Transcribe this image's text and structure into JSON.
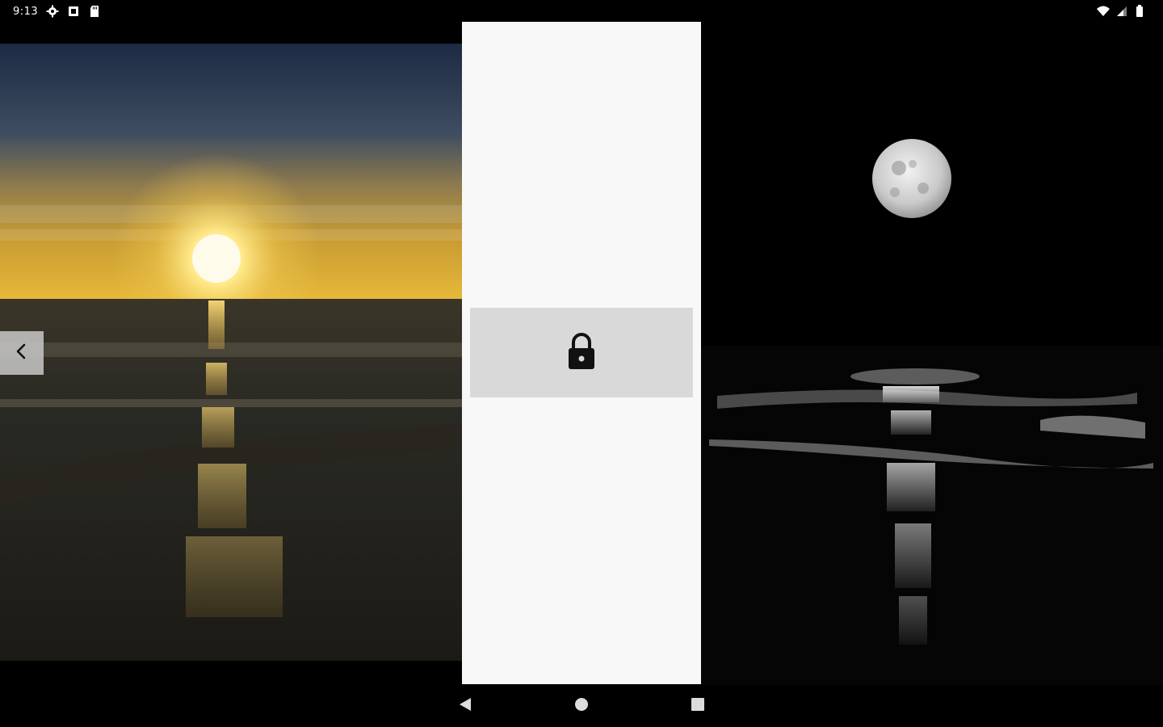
{
  "status_bar": {
    "time": "9:13",
    "left_icons": [
      "settings-icon",
      "sim-card-icon",
      "sd-card-icon"
    ],
    "right_icons": [
      "wifi-icon",
      "cell-signal-icon",
      "battery-icon"
    ]
  },
  "wallpapers": {
    "left": {
      "scene": "sunset-over-ocean"
    },
    "right": {
      "scene": "moon-over-ocean"
    }
  },
  "center_card": {
    "lock_icon": "lock-icon"
  },
  "nav_bar": {
    "buttons": [
      "back-icon",
      "home-icon",
      "recents-icon"
    ]
  },
  "colors": {
    "card_background": "#f8f8f8",
    "lock_button_background": "#d9d9d9",
    "icon_dark": "#111111",
    "system_bars": "#000000"
  }
}
